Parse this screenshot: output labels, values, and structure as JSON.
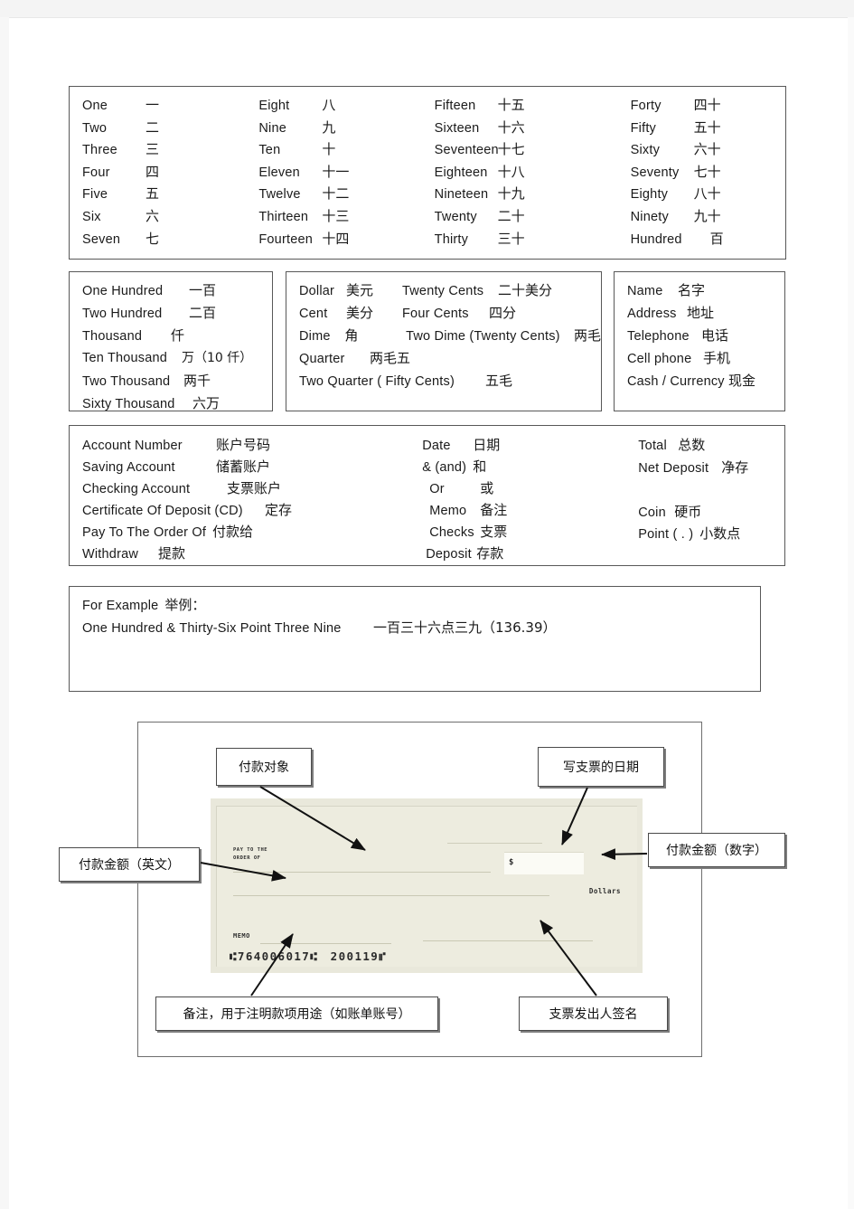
{
  "document": {
    "title": "Bank / Check English-Chinese Vocabulary Sheet"
  },
  "numbers_box": {
    "col1": [
      {
        "en": "One",
        "zh": "一"
      },
      {
        "en": "Two",
        "zh": "二"
      },
      {
        "en": "Three",
        "zh": "三"
      },
      {
        "en": "Four",
        "zh": "四"
      },
      {
        "en": "Five",
        "zh": "五"
      },
      {
        "en": "Six",
        "zh": "六"
      },
      {
        "en": "Seven",
        "zh": "七"
      }
    ],
    "col2": [
      {
        "en": "Eight",
        "zh": "八"
      },
      {
        "en": "Nine",
        "zh": "九"
      },
      {
        "en": "Ten",
        "zh": "十"
      },
      {
        "en": "Eleven",
        "zh": "十一"
      },
      {
        "en": "Twelve",
        "zh": "十二"
      },
      {
        "en": "Thirteen",
        "zh": "十三"
      },
      {
        "en": "Fourteen",
        "zh": "十四"
      }
    ],
    "col3": [
      {
        "en": "Fifteen",
        "zh": "十五"
      },
      {
        "en": "Sixteen",
        "zh": "十六"
      },
      {
        "en": "Seventeen",
        "zh": "十七"
      },
      {
        "en": "Eighteen",
        "zh": "十八"
      },
      {
        "en": "Nineteen",
        "zh": "十九"
      },
      {
        "en": "Twenty",
        "zh": "二十"
      },
      {
        "en": "Thirty",
        "zh": "三十"
      }
    ],
    "col4": [
      {
        "en": "Forty",
        "zh": "四十"
      },
      {
        "en": "Fifty",
        "zh": "五十"
      },
      {
        "en": "Sixty",
        "zh": "六十"
      },
      {
        "en": "Seventy",
        "zh": "七十"
      },
      {
        "en": "Eighty",
        "zh": "八十"
      },
      {
        "en": "Ninety",
        "zh": "九十"
      },
      {
        "en": "Hundred",
        "zh": "百"
      }
    ]
  },
  "big_numbers_box": {
    "rows": [
      {
        "en": "One   Hundred",
        "zh": "一百"
      },
      {
        "en": "Two   Hundred",
        "zh": "二百"
      },
      {
        "en": "Thousand",
        "zh": "仟"
      },
      {
        "en": "Ten   Thousand",
        "zh": "万（10 仟）"
      },
      {
        "en": "Two Thousand",
        "zh": "两千"
      },
      {
        "en": "Sixty   Thousand",
        "zh": "六万"
      }
    ]
  },
  "money_box": {
    "rows": [
      {
        "en": "Dollar",
        "zh": "美元",
        "en2": "Twenty Cents",
        "zh2": "二十美分"
      },
      {
        "en": "Cent",
        "zh": "美分",
        "en2": "Four Cents",
        "zh2": "四分"
      },
      {
        "en": "Dime",
        "zh": "角",
        "en2": "Two Dime (Twenty Cents)",
        "zh2": "两毛"
      },
      {
        "en": "Quarter",
        "zh": "两毛五",
        "en2": "",
        "zh2": ""
      },
      {
        "en": "Two Quarter ( Fifty Cents)",
        "zh": "五毛",
        "en2": "",
        "zh2": ""
      }
    ]
  },
  "contact_box": {
    "rows": [
      {
        "en": "Name",
        "zh": "名字"
      },
      {
        "en": "Address",
        "zh": "地址"
      },
      {
        "en": "Telephone",
        "zh": "电话"
      },
      {
        "en": "Cell  phone",
        "zh": "手机"
      },
      {
        "en": "Cash / Currency",
        "zh": "现金"
      }
    ]
  },
  "banking_box": {
    "col1": [
      {
        "en": "Account  Number",
        "zh": "账户号码"
      },
      {
        "en": "Saving   Account",
        "zh": "储蓄账户"
      },
      {
        "en": "Checking  Account",
        "zh": "支票账户"
      },
      {
        "en": "Certificate  Of  Deposit  (CD)",
        "zh": "定存"
      },
      {
        "en": "Pay To The Order Of",
        "zh": "付款给"
      },
      {
        "en": "Withdraw",
        "zh": "提款"
      }
    ],
    "col2": [
      {
        "en": "Date",
        "zh": "日期"
      },
      {
        "en": "& (and)",
        "zh": "和"
      },
      {
        "en": "Or",
        "zh": "或"
      },
      {
        "en": "Memo",
        "zh": "备注"
      },
      {
        "en": "Checks",
        "zh": "支票"
      },
      {
        "en": "Deposit",
        "zh": "存款"
      }
    ],
    "col3": [
      {
        "en": "Total",
        "zh": "总数"
      },
      {
        "en": "Net  Deposit",
        "zh": "净存"
      },
      {
        "en": "",
        "zh": ""
      },
      {
        "en": "Coin",
        "zh": "硬币"
      },
      {
        "en": "Point ( . )",
        "zh": "小数点"
      }
    ]
  },
  "example_box": {
    "heading_en": "For  Example",
    "heading_zh": "举例：",
    "line_en": "One  Hundred  &  Thirty-Six  Point  Three  Nine",
    "line_zh": "一百三十六点三九（136.39）"
  },
  "check_diagram": {
    "check_face": {
      "pay_to_the_line1": "PAY TO THE",
      "pay_to_the_line2": "ORDER OF",
      "dollars_label": "Dollars",
      "memo_label": "MEMO",
      "amount_currency_symbol": "$",
      "micr_routing": "⑆764006017⑆",
      "micr_account": "200119⑈"
    },
    "callouts": {
      "payee": "付款对象",
      "date": "写支票的日期",
      "amount_numeric": "付款金额（数字）",
      "amount_written": "付款金额（英文）",
      "memo": "备注，用于注明款项用途（如账单账号）",
      "signature": "支票发出人签名"
    }
  },
  "colors": {
    "check_paper": "#e9e8db",
    "check_inner": "#edecdf",
    "rule": "#c9c8b4",
    "border": "#585858",
    "text": "#1a1a1a"
  }
}
